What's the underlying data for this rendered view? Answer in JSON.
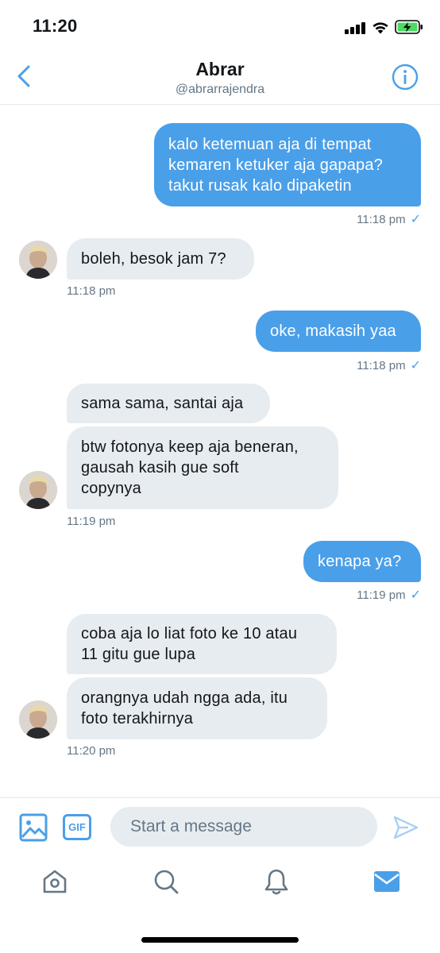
{
  "status_bar": {
    "time": "11:20"
  },
  "header": {
    "name": "Abrar",
    "handle": "@abrarrajendra"
  },
  "messages": [
    {
      "text": "kalo ketemuan aja di tempat\nkemaren ketuker aja gapapa?\ntakut rusak kalo dipaketin"
    },
    {
      "text": "boleh, besok jam 7?"
    },
    {
      "text": "oke, makasih yaa"
    },
    {
      "text": "sama sama, santai aja"
    },
    {
      "text": "btw fotonya keep aja beneran,\ngausah kasih gue soft\ncopynya"
    },
    {
      "text": "kenapa ya?"
    },
    {
      "text": "coba aja lo liat foto ke 10 atau\n11 gitu gue lupa"
    },
    {
      "text": "orangnya udah ngga ada, itu\nfoto terakhirnya"
    }
  ],
  "timestamps": {
    "t1": "11:18 pm",
    "t2": "11:18 pm",
    "t3": "11:18 pm",
    "t4": "11:19 pm",
    "t5": "11:19 pm",
    "t6": "11:20 pm"
  },
  "composer": {
    "placeholder": "Start a message",
    "gif_label": "GIF"
  },
  "colors": {
    "accent": "#4a9fe9",
    "incoming_bubble": "#e6ecf0",
    "muted_text": "#657786"
  },
  "icons": {
    "back": "chevron-left-icon",
    "info": "info-icon",
    "media": "image-icon",
    "send": "send-icon",
    "tabs": [
      "home-icon",
      "search-icon",
      "bell-icon",
      "mail-icon"
    ]
  },
  "active_tab": "messages"
}
